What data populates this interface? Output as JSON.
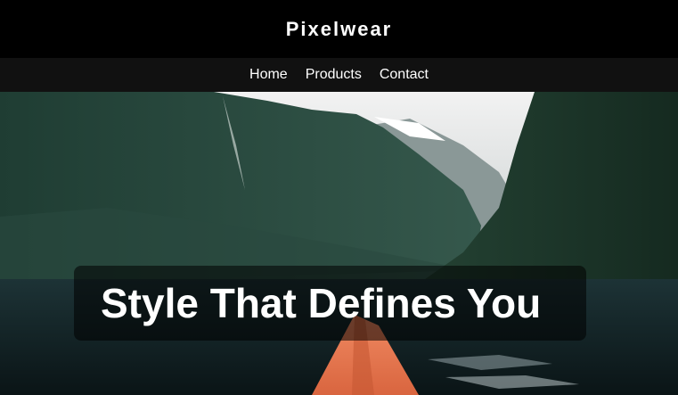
{
  "header": {
    "brand": "Pixelwear"
  },
  "nav": {
    "items": [
      {
        "label": "Home"
      },
      {
        "label": "Products"
      },
      {
        "label": "Contact"
      }
    ]
  },
  "hero": {
    "headline": "Style That Defines You",
    "image": "fjord-kayak-photo"
  },
  "colors": {
    "header_bg": "#000000",
    "nav_bg": "#111111",
    "text": "#ffffff",
    "kayak": "#e8734e"
  }
}
